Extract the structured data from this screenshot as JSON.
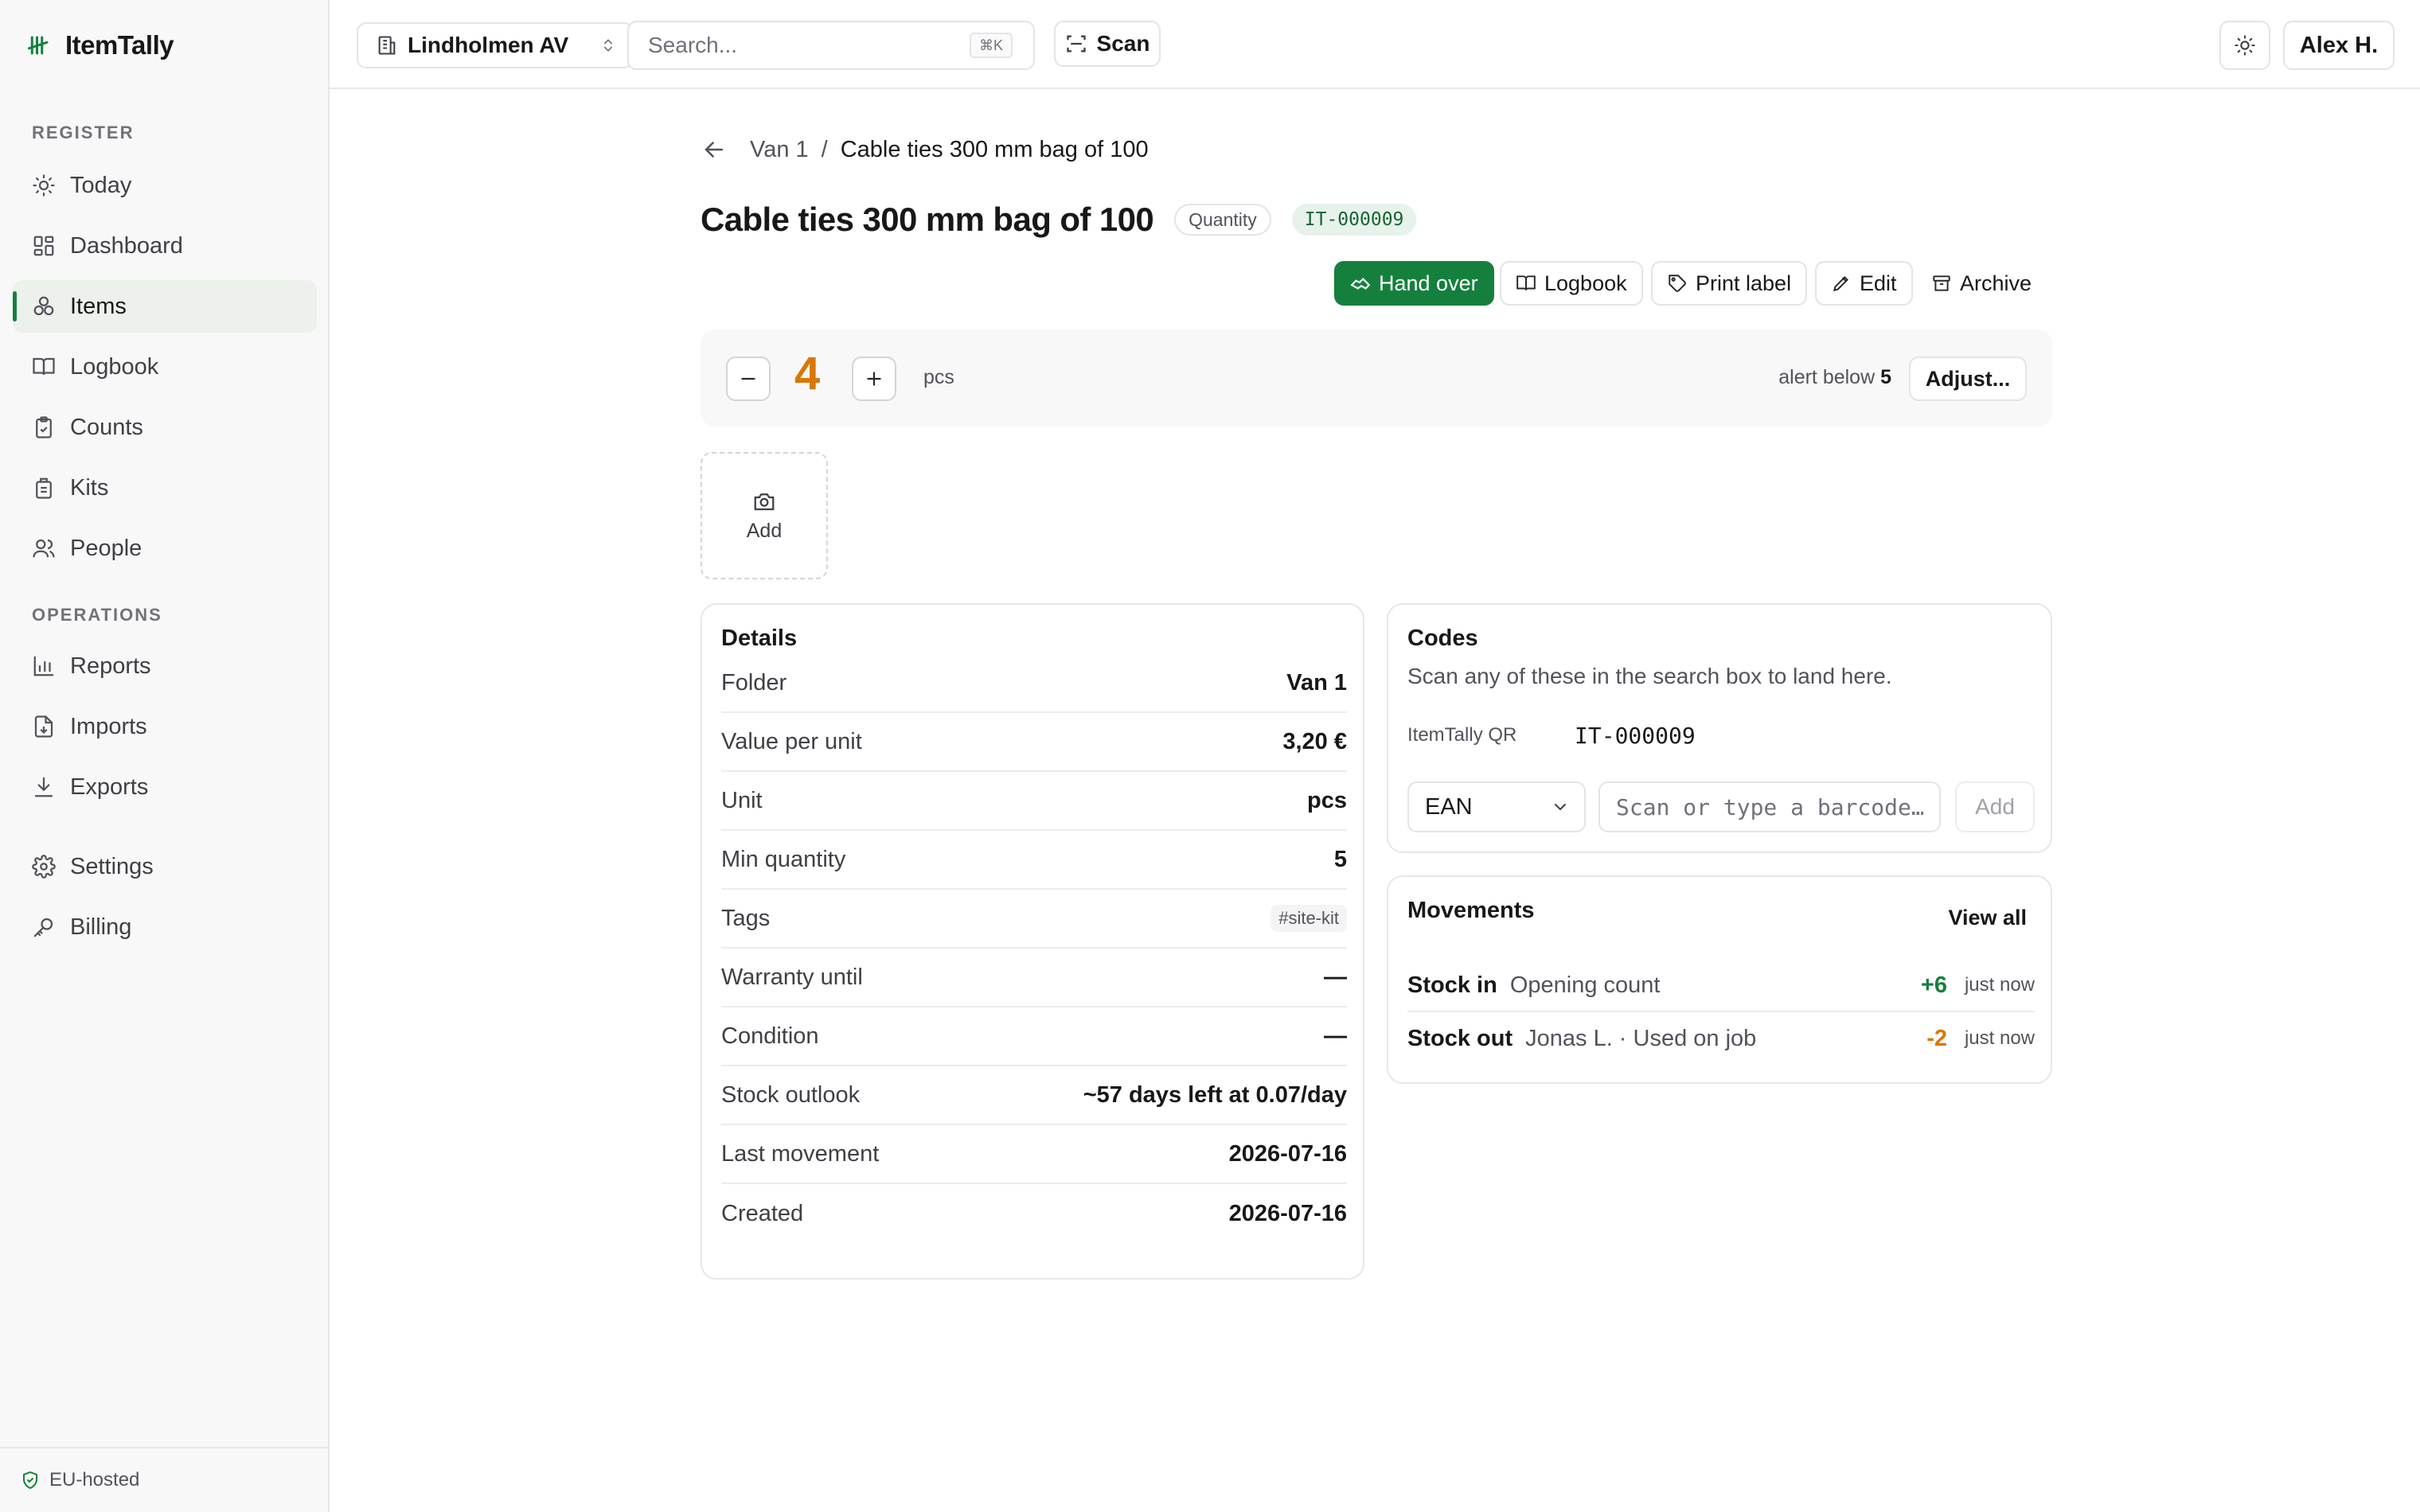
{
  "brand": {
    "name": "ItemTally"
  },
  "sidebar": {
    "register_heading": "REGISTER",
    "register_items": [
      {
        "label": "Today",
        "icon": "sun-icon"
      },
      {
        "label": "Dashboard",
        "icon": "dashboard-icon"
      },
      {
        "label": "Items",
        "icon": "items-icon",
        "active": true
      },
      {
        "label": "Logbook",
        "icon": "book-icon"
      },
      {
        "label": "Counts",
        "icon": "clipboard-icon"
      },
      {
        "label": "Kits",
        "icon": "kit-icon"
      },
      {
        "label": "People",
        "icon": "people-icon"
      }
    ],
    "operations_heading": "OPERATIONS",
    "operations_items": [
      {
        "label": "Reports",
        "icon": "chart-icon"
      },
      {
        "label": "Imports",
        "icon": "import-icon"
      },
      {
        "label": "Exports",
        "icon": "download-icon"
      }
    ],
    "settings_items": [
      {
        "label": "Settings",
        "icon": "gear-icon"
      },
      {
        "label": "Billing",
        "icon": "key-icon"
      }
    ],
    "footer": "EU-hosted"
  },
  "topbar": {
    "org": "Lindholmen AV",
    "search_placeholder": "Search...",
    "shortcut": "⌘K",
    "scan_label": "Scan",
    "user": "Alex H."
  },
  "breadcrumb": {
    "parent": "Van 1",
    "separator": "/",
    "current": "Cable ties 300 mm bag of 100"
  },
  "item": {
    "title": "Cable ties 300 mm bag of 100",
    "type_badge": "Quantity",
    "id_badge": "IT-000009"
  },
  "actions": {
    "hand_over": "Hand over",
    "logbook": "Logbook",
    "print_label": "Print label",
    "edit": "Edit",
    "archive": "Archive"
  },
  "quantity": {
    "value": "4",
    "unit": "pcs",
    "alert_prefix": "alert below",
    "alert_value": "5",
    "adjust_label": "Adjust...",
    "value_color": "#d97706"
  },
  "photo": {
    "add_label": "Add"
  },
  "details": {
    "title": "Details",
    "rows": [
      {
        "key": "Folder",
        "value": "Van 1"
      },
      {
        "key": "Value per unit",
        "value": "3,20 €"
      },
      {
        "key": "Unit",
        "value": "pcs"
      },
      {
        "key": "Min quantity",
        "value": "5"
      },
      {
        "key": "Tags",
        "value": "#site-kit"
      },
      {
        "key": "Warranty until",
        "value": "—"
      },
      {
        "key": "Condition",
        "value": "—"
      },
      {
        "key": "Stock outlook",
        "value": "~57 days left at 0.07/day"
      },
      {
        "key": "Last movement",
        "value": "2026-07-16"
      },
      {
        "key": "Created",
        "value": "2026-07-16"
      }
    ]
  },
  "codes": {
    "title": "Codes",
    "subtitle": "Scan any of these in the search box to land here.",
    "qr_label": "ItemTally QR",
    "qr_value": "IT-000009",
    "type_selected": "EAN",
    "input_placeholder": "Scan or type a barcode…",
    "add_label": "Add"
  },
  "movements": {
    "title": "Movements",
    "view_all": "View all",
    "rows": [
      {
        "type": "Stock in",
        "note": "Opening count",
        "delta": "+6",
        "time": "just now"
      },
      {
        "type": "Stock out",
        "note": "Jonas L. · Used on job",
        "delta": "-2",
        "time": "just now"
      }
    ]
  },
  "colors": {
    "accent": "#15803d",
    "warning": "#d97706"
  }
}
